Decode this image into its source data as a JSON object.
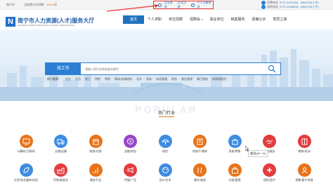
{
  "topbar": {
    "city": "南宁市",
    "visits_prefix": "当前累计访问数：",
    "visits_count": "15644",
    "visits_suffix": "次",
    "login_enterprise": "企业登录",
    "register_enterprise": "企业注册",
    "personal_center": "个人注册登录",
    "hotline_label_1": "招聘电话",
    "hotline_1": "0771-2422186、5381132(人才)",
    "hotline_label_2": "求职电话",
    "hotline_2": "0771-2429836、5381133(人才)"
  },
  "header": {
    "logo_letter": "N",
    "logo_cn": "南宁市人力资源(人才)服务大厅",
    "logo_en": "NANNING HUMAN RESOURCES (TALENT) SERVICE HALL"
  },
  "nav": {
    "items": [
      {
        "label": "首页",
        "active": true,
        "caret": false
      },
      {
        "label": "个人求职",
        "active": false,
        "caret": false
      },
      {
        "label": "单位招聘",
        "active": false,
        "caret": false
      },
      {
        "label": "招聘会",
        "active": false,
        "caret": true
      },
      {
        "label": "事业单位",
        "active": false,
        "caret": false
      },
      {
        "label": "档案服务",
        "active": false,
        "caret": false
      },
      {
        "label": "政策公示",
        "active": false,
        "caret": false
      },
      {
        "label": "党员之家",
        "active": false,
        "caret": false
      }
    ]
  },
  "search": {
    "button": "找工作",
    "placeholder": "请输入职位名称或者关键字"
  },
  "hot_keywords": [
    "热门搜索：",
    "会计",
    "文员",
    "普工",
    "销售",
    "营销",
    "模具/机械结构",
    "设计",
    "保安",
    "电话客服",
    "财务",
    "物业管理",
    "餐厅服务",
    "网络管理员"
  ],
  "section": {
    "watermark": "POPULAR",
    "title": "热门行业"
  },
  "industries": [
    {
      "label": "计算机/互联网",
      "color": "#e8731a",
      "icon": "computer-icon"
    },
    {
      "label": "交通/运输",
      "color": "#3d8de0",
      "icon": "truck-icon"
    },
    {
      "label": "物流/仓储",
      "color": "#e8731a",
      "icon": "box-icon"
    },
    {
      "label": "金融/财务",
      "color": "#9a45c9",
      "icon": "coin-icon"
    },
    {
      "label": "保险",
      "color": "#3d8de0",
      "icon": "umbrella-icon"
    },
    {
      "label": "房地产/建筑",
      "color": "#e8731a",
      "icon": "building-icon"
    },
    {
      "label": "贸易/零售",
      "color": "#3d8de0",
      "icon": "bag-icon"
    },
    {
      "label": "商业服务",
      "color": "#e33d3d",
      "icon": "handshake-icon"
    },
    {
      "label": "教育/培训",
      "color": "#e33d3d",
      "icon": "book-icon"
    },
    {
      "label": "天然/农业服饰/纺织",
      "color": "#3d8de0",
      "icon": "leaf-icon"
    },
    {
      "label": "环保/制造业",
      "color": "#e33d3d",
      "icon": "factory-icon"
    },
    {
      "label": "通信/行业",
      "color": "#e8731a",
      "icon": "signal-icon"
    },
    {
      "label": "传媒/广告",
      "color": "#e33d3d",
      "icon": "megaphone-icon"
    },
    {
      "label": "设计/艺术",
      "color": "#3d8de0",
      "icon": "palette-icon"
    },
    {
      "label": "餐饮/旅游",
      "color": "#e8731a",
      "icon": "food-icon"
    },
    {
      "label": "行政/管理",
      "color": "#e8731a",
      "icon": "briefcase-icon"
    },
    {
      "label": "保险/医疗",
      "color": "#e33d3d",
      "icon": "medical-icon"
    },
    {
      "label": "销售/客户经理",
      "color": "#e8731a",
      "icon": "user-icon"
    }
  ],
  "tooltip": "美团(All + A)"
}
